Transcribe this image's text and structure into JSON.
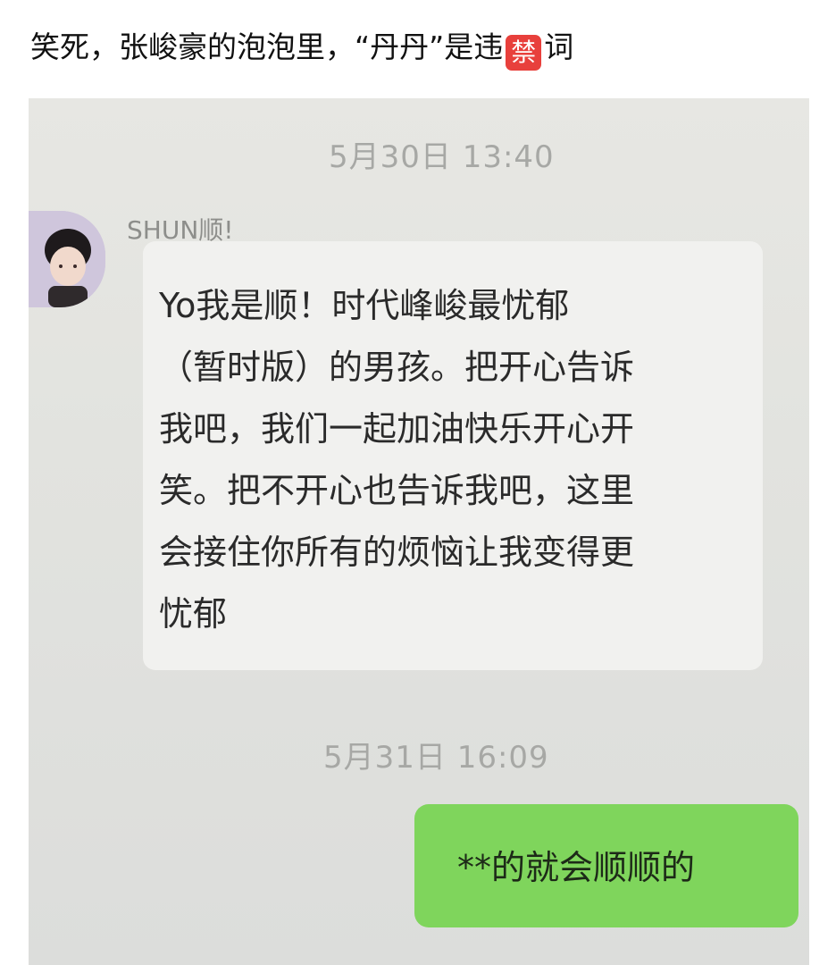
{
  "post": {
    "caption_before": "笑死，张峻豪的泡泡里，“丹丹”是违",
    "caption_emoji": "禁",
    "caption_after": "词"
  },
  "chat": {
    "timestamp_1": "5月30日 13:40",
    "sender_name": "SHUN顺!",
    "incoming_message": "Yo我是顺！时代峰峻最忧郁\n（暂时版）的男孩。把开心告诉\n我吧，我们一起加油快乐开心开\n笑。把不开心也告诉我吧，这里\n会接住你所有的烦恼让我变得更\n忧郁",
    "timestamp_2": "5月31日 16:09",
    "outgoing_message": "**的就会顺顺的"
  },
  "colors": {
    "outgoing_bubble": "#7fd55c",
    "incoming_bubble": "#f1f1ef",
    "ban_emoji": "#e8403c"
  }
}
